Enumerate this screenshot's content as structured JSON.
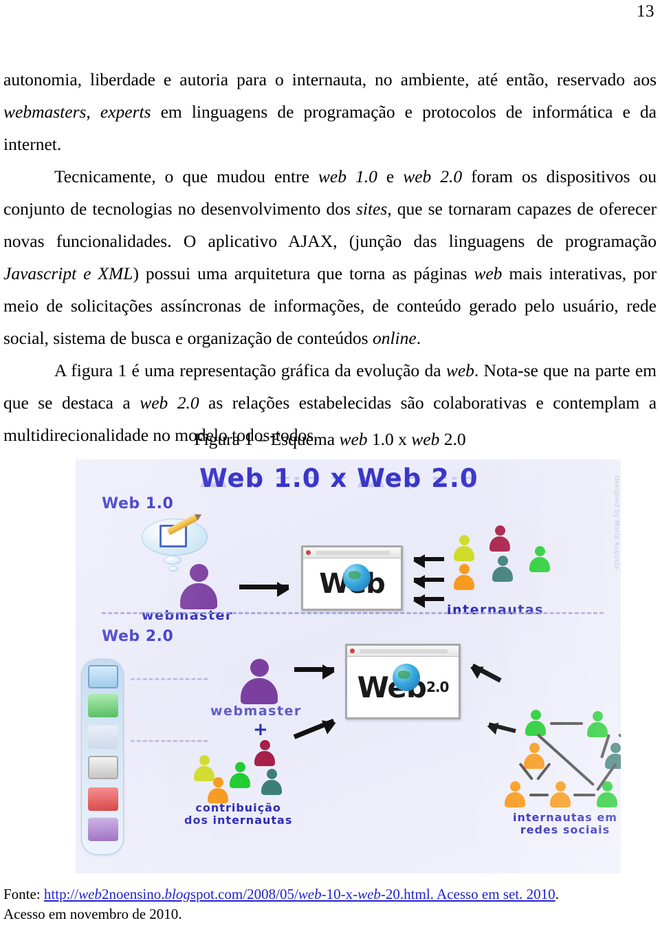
{
  "page": {
    "number": "13"
  },
  "body": {
    "paragraphs": [
      {
        "indent": false,
        "runs": [
          {
            "t": "autonomia, liberdade e autoria para o internauta, no ambiente, até então, reservado aos ",
            "i": false
          },
          {
            "t": "webmasters",
            "i": true
          },
          {
            "t": ", ",
            "i": false
          },
          {
            "t": "experts",
            "i": true
          },
          {
            "t": " em linguagens de programação e protocolos de informática e da internet.",
            "i": false
          }
        ]
      },
      {
        "indent": true,
        "runs": [
          {
            "t": "Tecnicamente, o que mudou entre ",
            "i": false
          },
          {
            "t": "web 1.0",
            "i": true
          },
          {
            "t": " e ",
            "i": false
          },
          {
            "t": "web 2.0",
            "i": true
          },
          {
            "t": " foram os dispositivos ou conjunto de tecnologias no desenvolvimento dos ",
            "i": false
          },
          {
            "t": "sites",
            "i": true
          },
          {
            "t": ", que se tornaram capazes de oferecer novas funcionalidades. O aplicativo AJAX, (junção das linguagens de programação ",
            "i": false
          },
          {
            "t": "Javascript e XML",
            "i": true
          },
          {
            "t": ") possui uma arquitetura que torna as páginas ",
            "i": false
          },
          {
            "t": "web",
            "i": true
          },
          {
            "t": " mais interativas, por meio de solicitações assíncronas de informações, de conteúdo gerado pelo usuário, rede social, sistema de busca e organização de conteúdos ",
            "i": false
          },
          {
            "t": "online",
            "i": true
          },
          {
            "t": ".",
            "i": false
          }
        ]
      },
      {
        "indent": true,
        "runs": [
          {
            "t": "A figura 1 é uma representação gráfica da evolução da ",
            "i": false
          },
          {
            "t": "web",
            "i": true
          },
          {
            "t": ".  Nota-se que na parte em que se destaca a ",
            "i": false
          },
          {
            "t": "web 2.0",
            "i": true
          },
          {
            "t": " as relações estabelecidas são colaborativas e contemplam a multidirecionalidade no modelo todos-todos.",
            "i": false
          }
        ]
      }
    ]
  },
  "figure_caption": {
    "prefix": "Figura 1 – Esquema ",
    "web_a": "web",
    "mid_a": " 1.0 x ",
    "web_b": "web",
    "mid_b": " 2.0"
  },
  "figure": {
    "title": "Web 1.0  x Web 2.0",
    "section_web10_label": "Web 1.0",
    "section_web20_label": "Web 2.0",
    "webmaster_label_top": "webmaster",
    "webmaster_label_bottom": "webmaster",
    "internautas_label": "internautas",
    "contribuicao_label_line1": "contribuição",
    "contribuicao_label_line2": "dos internautas",
    "redes_label_line1": "internautas em",
    "redes_label_line2": "redes sociais",
    "plus": "+",
    "browser_web_text": "Web",
    "browser_web20_text": "Web",
    "browser_web20_sub": "2.0",
    "watermark": "Designed by Maria Augusta",
    "colors": {
      "title_blue": "#3a36c8",
      "label_blue": "#2d2ab8",
      "background": "#eeeefb",
      "webmaster_purple": "#7b3fa0",
      "person_yellow": "#cfdc2a",
      "person_crimson": "#a8204a",
      "person_green": "#22cc33",
      "person_orange": "#f79a1e",
      "person_teal": "#3d7f77"
    }
  },
  "source": {
    "label": "Fonte: ",
    "url_parts": [
      {
        "t": "http://",
        "i": false
      },
      {
        "t": "web",
        "i": true
      },
      {
        "t": "2noensino.",
        "i": false
      },
      {
        "t": "blog",
        "i": true
      },
      {
        "t": "spot.com/2008/05/",
        "i": false
      },
      {
        "t": "web",
        "i": true
      },
      {
        "t": "-10-x-",
        "i": false
      },
      {
        "t": "web",
        "i": true
      },
      {
        "t": "-20.html. Acesso em set. 2010",
        "i": false
      }
    ],
    "tail": ".",
    "line2": "Acesso em novembro de 2010."
  }
}
